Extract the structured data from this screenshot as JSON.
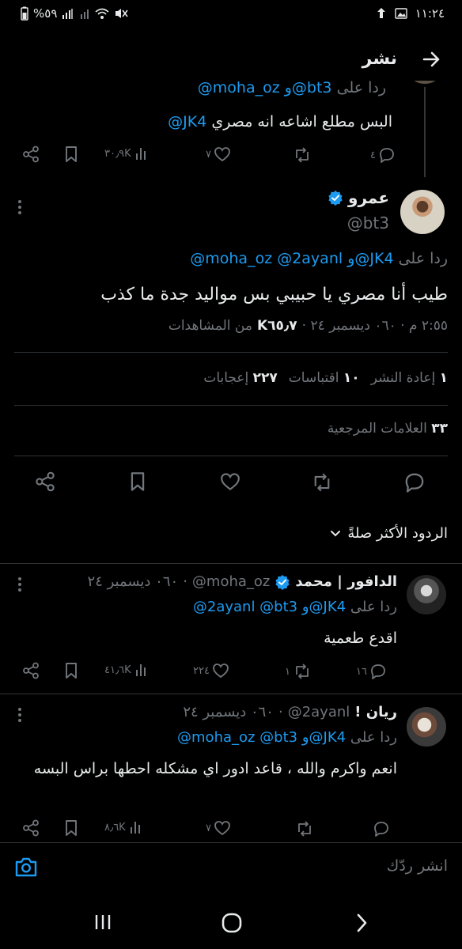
{
  "status_bar": {
    "time": "١١:٢٤",
    "battery": "%٥٩"
  },
  "header": {
    "title": "نشر"
  },
  "prev_tweet": {
    "reply_to_prefix": "ردا على",
    "reply_to_users": "@moha_oz و@bt3",
    "text_prefix": "البس مطلع اشاعه انه مصري",
    "text_mention": "@JK4",
    "views": "٣٠٫٩K",
    "likes": "٧",
    "reposts": "",
    "replies": "٤"
  },
  "main_tweet": {
    "name": "عمرو",
    "handle": "@bt3",
    "reply_to_prefix": "ردا على",
    "reply_to_users": "@moha_oz @2ayanl و@JK4",
    "text": "طيب أنا مصري يا حبيبي بس مواليد جدة ما كذب",
    "timestamp": "٢:٥٥ م · ٠٦٠ ديسمبر ٢٤ ·",
    "views_count": "K٦٥٫٧",
    "views_label": "من المشاهدات",
    "reposts_count": "١",
    "reposts_label": "إعادة النشر",
    "quotes_count": "١٠",
    "quotes_label": "اقتباسات",
    "likes_count": "٢٢٧",
    "likes_label": "إعجابات",
    "bookmarks_count": "٣٣",
    "bookmarks_label": "العلامات المرجعية"
  },
  "sort": {
    "label": "الردود الأكثر صلةً"
  },
  "replies": [
    {
      "name": "الدافور | محمد",
      "handle": "@moha_oz",
      "date": "٠٦٠ ديسمبر ٢٤",
      "reply_to_prefix": "ردا على",
      "reply_to_users": "@2ayanl @bt3 و@JK4",
      "text": "اقدع طعمية",
      "replies": "١٦",
      "reposts": "١",
      "likes": "٢٢٤",
      "views": "٤١٫٦K"
    },
    {
      "name": "ريان !",
      "handle": "@2ayanl",
      "date": "٠٦٠ ديسمبر ٢٤",
      "reply_to_prefix": "ردا على",
      "reply_to_users": "@moha_oz @bt3 و@JK4",
      "text": "انعم واكرم والله ، قاعد ادور اي مشكله احطها براس البسه",
      "replies": "",
      "reposts": "",
      "likes": "٧",
      "views": "٨٫٦K"
    }
  ],
  "composer": {
    "placeholder": "انشر ردّك"
  },
  "colors": {
    "background": "#000000",
    "text": "#e7e9ea",
    "muted": "#71767b",
    "accent": "#1d9bf0"
  }
}
